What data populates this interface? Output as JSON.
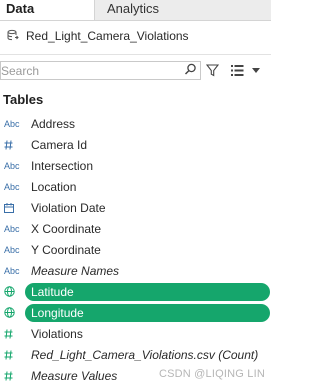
{
  "tabs": {
    "data": "Data",
    "analytics": "Analytics"
  },
  "datasource": {
    "name": "Red_Light_Camera_Violations",
    "icon": "datasource-icon"
  },
  "search": {
    "placeholder": "Search",
    "value": ""
  },
  "section": {
    "title": "Tables"
  },
  "fields": [
    {
      "type": "Abc",
      "name": "Address"
    },
    {
      "type": "#",
      "name": "Camera Id"
    },
    {
      "type": "Abc",
      "name": "Intersection"
    },
    {
      "type": "Abc",
      "name": "Location"
    },
    {
      "type": "calendar",
      "name": "Violation Date"
    },
    {
      "type": "Abc",
      "name": "X Coordinate"
    },
    {
      "type": "Abc",
      "name": "Y Coordinate"
    },
    {
      "type": "Abc",
      "name": "Measure Names"
    },
    {
      "type": "globe",
      "name": "Latitude"
    },
    {
      "type": "globe",
      "name": "Longitude"
    },
    {
      "type": "#",
      "name": "Violations"
    },
    {
      "type": "#",
      "name": "Red_Light_Camera_Violations.csv (Count)"
    },
    {
      "type": "#",
      "name": "Measure Values"
    }
  ],
  "watermark": "CSDN @LIQING LIN",
  "colors": {
    "selected": "#15a66c",
    "type_icon": "#3a6fa8"
  }
}
